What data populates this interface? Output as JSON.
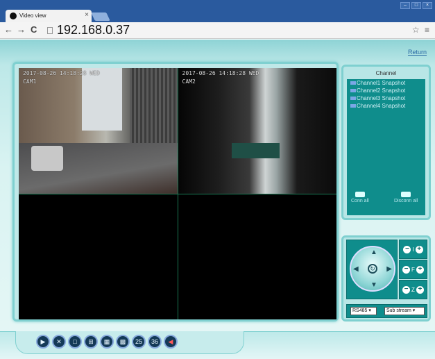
{
  "browser": {
    "tab_title": "Video view",
    "tab_close": "×",
    "nav_back": "←",
    "nav_forward": "→",
    "nav_reload": "C",
    "url": "192.168.0.37",
    "right_icons": "☆ ≡",
    "window_buttons": [
      "–",
      "□",
      "×"
    ]
  },
  "app": {
    "return_label": "Return",
    "cameras": [
      {
        "osd_time": "2017-08-26 14:18:28 WED",
        "osd_name": "CAM1"
      },
      {
        "osd_time": "2017-08-26 14:18:28 WED",
        "osd_name": "CAM2"
      },
      {
        "osd_time": "",
        "osd_name": ""
      },
      {
        "osd_time": "",
        "osd_name": ""
      }
    ],
    "channel_panel": {
      "title": "Channel",
      "items": [
        "Channel1 Snapshot",
        "Channel2 Snapshot",
        "Channel3 Snapshot",
        "Channel4 Snapshot"
      ],
      "conn_all": "Conn all",
      "disconn_all": "Disconn all"
    },
    "ptz": {
      "iris_label": "I",
      "focus_label": "F",
      "zoom_label": "Z",
      "protocol_select": "RS485 ▾",
      "stream_select": "Sub stream ▾"
    },
    "toolbar_buttons": [
      {
        "name": "record-button",
        "glyph": "▶"
      },
      {
        "name": "settings-button",
        "glyph": "✕"
      },
      {
        "name": "layout-1-button",
        "glyph": "□"
      },
      {
        "name": "layout-4-button",
        "glyph": "⊞"
      },
      {
        "name": "layout-9-button",
        "glyph": "▦"
      },
      {
        "name": "layout-16-button",
        "glyph": "▩"
      },
      {
        "name": "layout-25-button",
        "glyph": "25"
      },
      {
        "name": "layout-36-button",
        "glyph": "36"
      },
      {
        "name": "volume-button",
        "glyph": "◀"
      }
    ]
  }
}
